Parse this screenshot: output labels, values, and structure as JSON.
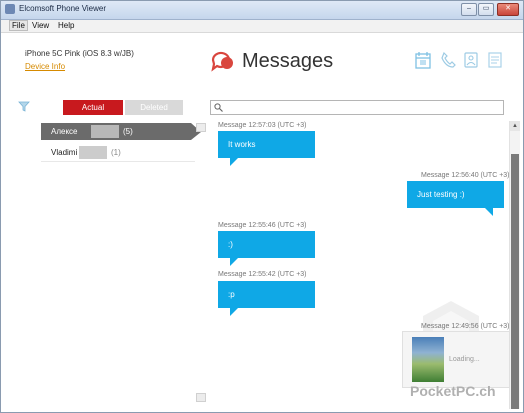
{
  "window": {
    "title": "Elcomsoft Phone Viewer",
    "controls": [
      "–",
      "▭",
      "✕"
    ]
  },
  "menu": {
    "items": [
      "File",
      "View",
      "Help"
    ]
  },
  "device": {
    "name": "iPhone 5C Pink (iOS 8.3 w/JB)",
    "info_link": "Device Info"
  },
  "header": {
    "title": "Messages"
  },
  "filter": {
    "tab_actual": "Actual",
    "tab_deleted": "Deleted"
  },
  "contacts": [
    {
      "name": "Алексе",
      "count": "(5)"
    },
    {
      "name": "Vladimi",
      "count": "(1)"
    }
  ],
  "search": {
    "placeholder": ""
  },
  "messages": [
    {
      "meta": "Message 12:57:03 (UTC +3)",
      "text": "It works"
    },
    {
      "meta": "Message 12:56:40 (UTC +3)",
      "text": "Just testing :)"
    },
    {
      "meta": "Message 12:55:46 (UTC +3)",
      "text": ":)"
    },
    {
      "meta": "Message 12:55:42 (UTC +3)",
      "text": ":p"
    },
    {
      "meta": "Message 12:49:56 (UTC +3)",
      "text": "Loading..."
    }
  ],
  "watermark": {
    "text": "PocketPC.ch"
  },
  "colors": {
    "accent_red": "#c8191e",
    "bubble_blue": "#0fa8e6",
    "link_orange": "#d68a00"
  }
}
